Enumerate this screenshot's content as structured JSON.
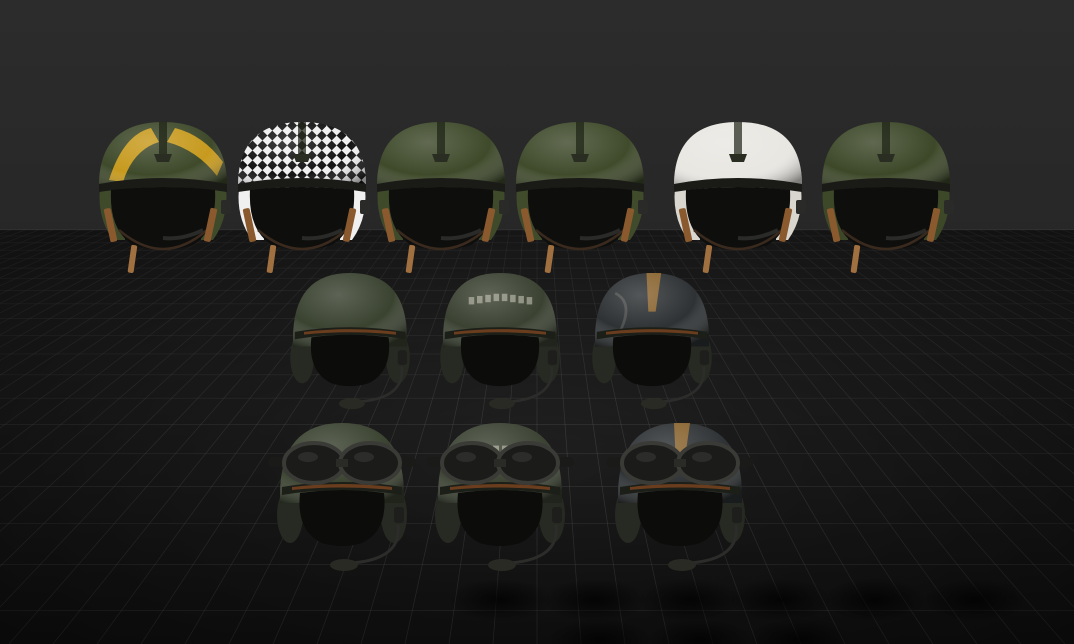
{
  "scene": {
    "background_colors": {
      "top": "#2c2c2c",
      "bottom": "#141414",
      "grid_line": "#5a5a5a"
    },
    "helmets": [
      {
        "model": "flight",
        "pattern": "yellow-chevron",
        "shell_color": "#3f4a2b",
        "accent_color": "#c79a1e"
      },
      {
        "model": "flight",
        "pattern": "checkerboard",
        "shell_color": "#f0f0f0",
        "accent_color": "#141414"
      },
      {
        "model": "flight",
        "pattern": "plain",
        "shell_color": "#3f4a2b",
        "accent_color": ""
      },
      {
        "model": "flight",
        "pattern": "plain",
        "shell_color": "#404b2c",
        "accent_color": ""
      },
      {
        "model": "flight",
        "pattern": "plain",
        "shell_color": "#e9e7e2",
        "accent_color": ""
      },
      {
        "model": "flight",
        "pattern": "plain",
        "shell_color": "#3d4829",
        "accent_color": ""
      },
      {
        "model": "tanker",
        "pattern": "plain",
        "shell_color": "#3a4230",
        "accent_color": ""
      },
      {
        "model": "tanker",
        "pattern": "painted-lettering",
        "shell_color": "#3b4232",
        "accent_color": "#a5a596"
      },
      {
        "model": "tanker",
        "pattern": "worn-stripe",
        "shell_color": "#2e3234",
        "accent_color": "#a0702f"
      },
      {
        "model": "tanker-goggles",
        "pattern": "plain",
        "shell_color": "#3a4230",
        "accent_color": ""
      },
      {
        "model": "tanker-goggles",
        "pattern": "painted-lettering",
        "shell_color": "#3b4232",
        "accent_color": "#a5a596"
      },
      {
        "model": "tanker-goggles",
        "pattern": "worn-stripe",
        "shell_color": "#2e3234",
        "accent_color": "#a0702f"
      }
    ]
  }
}
